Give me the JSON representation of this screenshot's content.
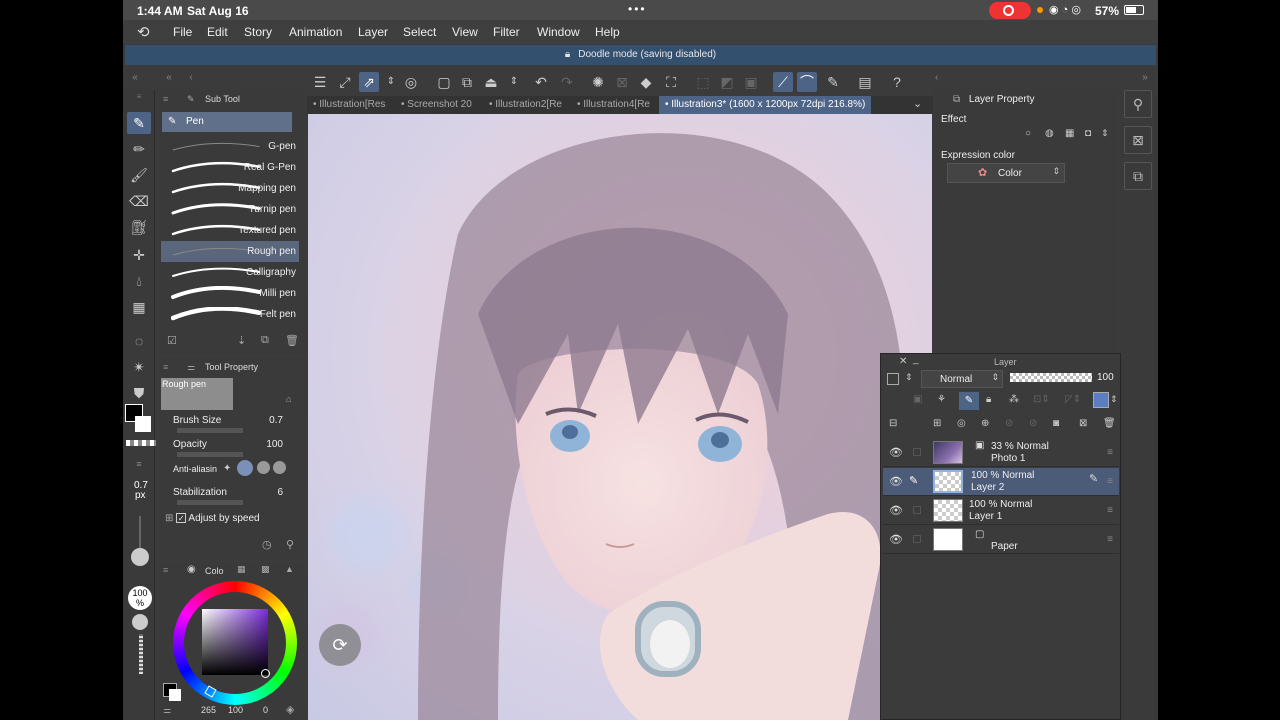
{
  "status": {
    "time": "1:44 AM",
    "date": "Sat Aug 16",
    "battery": "57%"
  },
  "menu": [
    "File",
    "Edit",
    "Story",
    "Animation",
    "Layer",
    "Select",
    "View",
    "Filter",
    "Window",
    "Help"
  ],
  "banner": "Doodle mode (saving disabled)",
  "tabs": [
    "Illustration[Res",
    "Screenshot 20",
    "Illustration2[Re",
    "Illustration4[Re",
    "Illustration3* (1600 x 1200px 72dpi 216.8%)"
  ],
  "subtool": {
    "title": "Sub Tool",
    "group": "Pen",
    "brushes": [
      "G-pen",
      "Real G-Pen",
      "Mapping pen",
      "Turnip pen",
      "Textured pen",
      "Rough pen",
      "Calligraphy",
      "Milli pen",
      "Felt pen"
    ]
  },
  "toolprop": {
    "title": "Tool Property",
    "preset": "Rough pen",
    "brush_size_label": "Brush Size",
    "brush_size": "0.7",
    "opacity_label": "Opacity",
    "opacity": "100",
    "aa_label": "Anti-aliasin",
    "stab_label": "Stabilization",
    "stab": "6",
    "adjust_label": "Adjust by speed"
  },
  "sizeind": {
    "size": "0.7",
    "unit": "px",
    "opacity": "100",
    "opacity_unit": "%"
  },
  "colorpal": {
    "title": "Colo",
    "readout_1": "265",
    "readout_2": "100",
    "readout_3": "0"
  },
  "layerprop": {
    "title": "Layer Property",
    "effect_label": "Effect",
    "expr_label": "Expression color",
    "expr_value": "Color"
  },
  "layerpal": {
    "title": "Layer",
    "blend": "Normal",
    "opacity": "100",
    "layers": [
      {
        "pct": "33 %  Normal",
        "name": "Photo 1"
      },
      {
        "pct": "100 %  Normal",
        "name": "Layer 2"
      },
      {
        "pct": "100 %  Normal",
        "name": "Layer 1"
      },
      {
        "pct": "",
        "name": "Paper"
      }
    ]
  }
}
